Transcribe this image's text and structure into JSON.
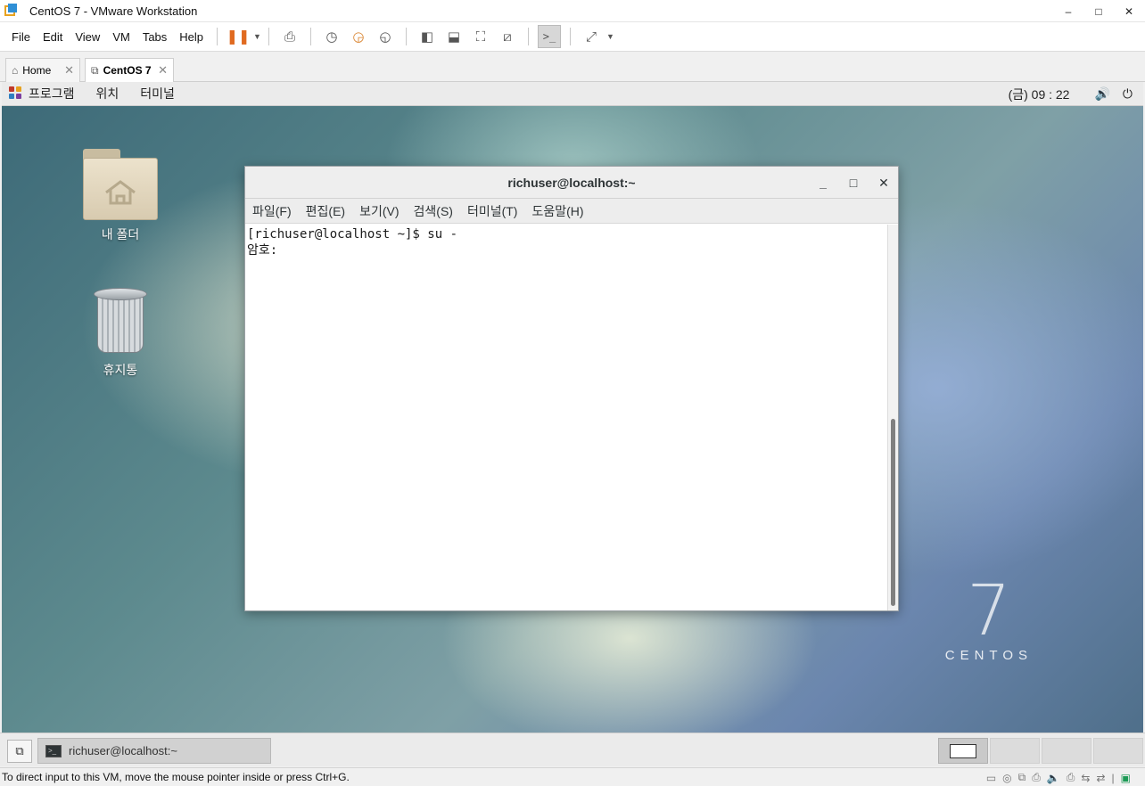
{
  "window": {
    "title": "CentOS 7 - VMware Workstation",
    "controls": [
      "–",
      "□",
      "✕"
    ]
  },
  "menu": [
    "File",
    "Edit",
    "View",
    "VM",
    "Tabs",
    "Help"
  ],
  "tabs": [
    {
      "label": "Home",
      "icon": "home-icon"
    },
    {
      "label": "CentOS 7",
      "icon": "vm-icon"
    }
  ],
  "gnome_panel": {
    "menus": [
      "프로그램",
      "위치",
      "터미널"
    ],
    "clock": "(금) 09 : 22"
  },
  "desktop": {
    "icons": [
      {
        "label": "내 폴더",
        "icon": "home-folder-icon"
      },
      {
        "label": "휴지통",
        "icon": "trash-icon"
      }
    ],
    "logo": {
      "number": "7",
      "text": "CENTOS"
    }
  },
  "terminal": {
    "title": "richuser@localhost:~",
    "menus": [
      "파일(F)",
      "편집(E)",
      "보기(V)",
      "검색(S)",
      "터미널(T)",
      "도움말(H)"
    ],
    "lines": [
      "[richuser@localhost ~]$ su -",
      "암호:"
    ]
  },
  "taskbar": {
    "task_label": "richuser@localhost:~",
    "workspaces": 4
  },
  "statusbar": {
    "message": "To direct input to this VM, move the mouse pointer inside or press Ctrl+G."
  }
}
